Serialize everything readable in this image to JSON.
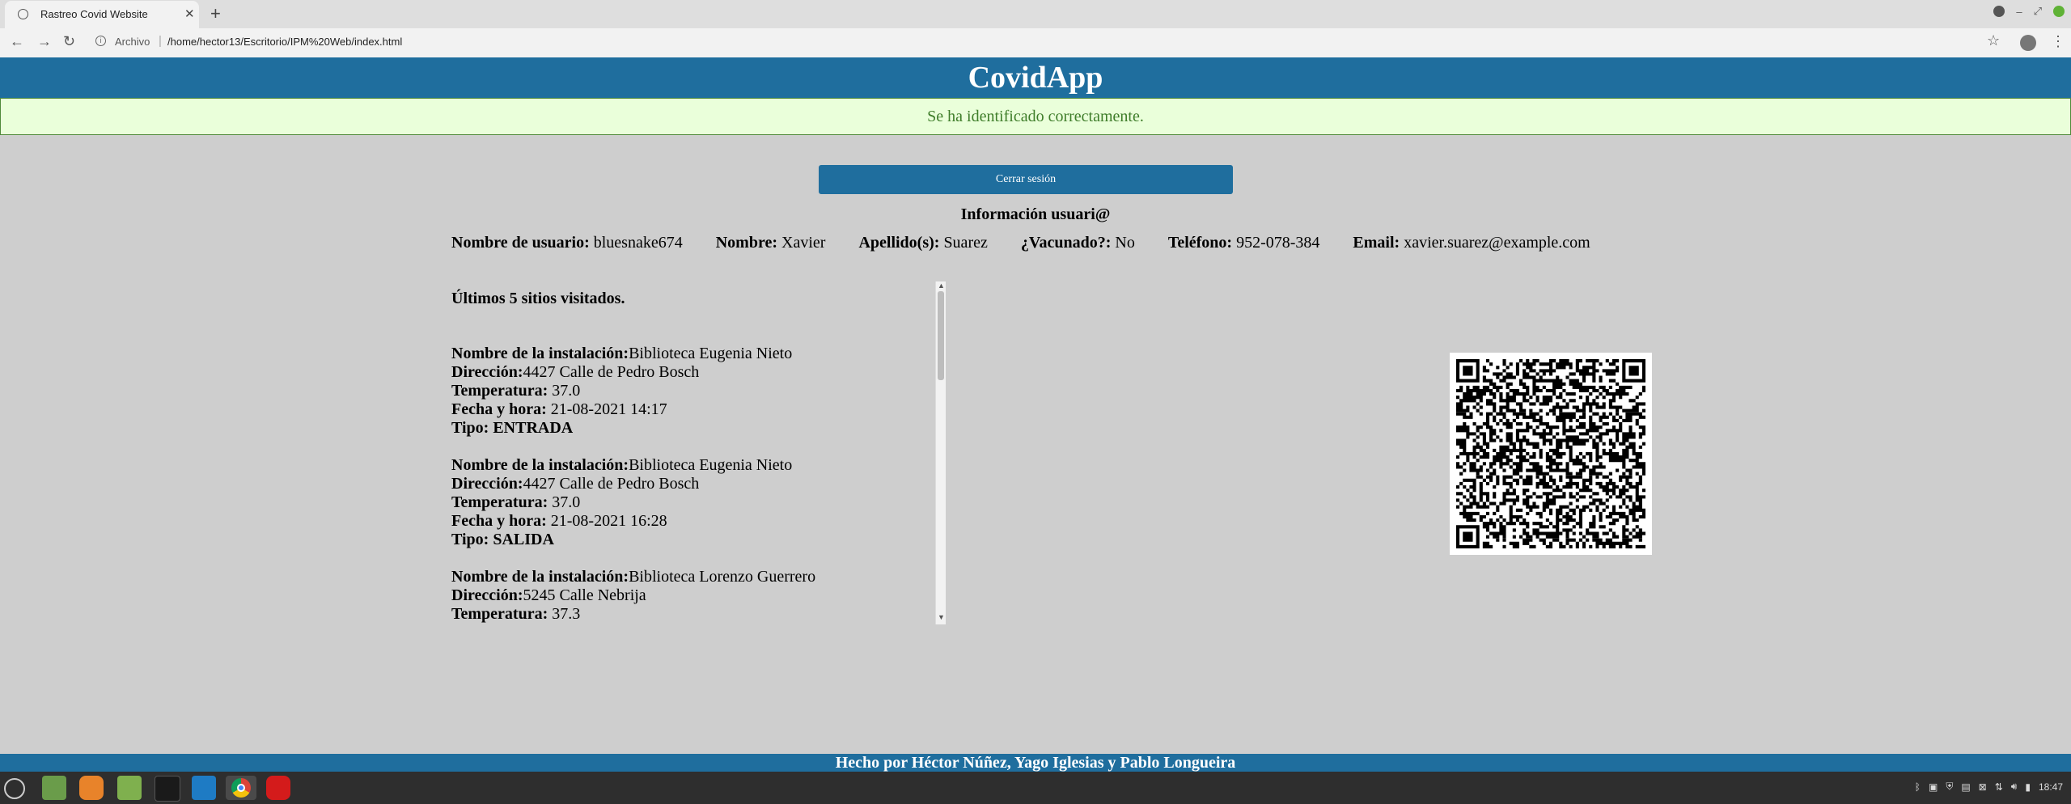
{
  "browser": {
    "tab_title": "Rastreo Covid Website",
    "url_label": "Archivo",
    "url": "/home/hector13/Escritorio/IPM%20Web/index.html"
  },
  "page": {
    "app_title": "CovidApp",
    "alert": "Se ha identificado correctamente.",
    "logout_label": "Cerrar sesión",
    "info_title": "Información usuari@",
    "user_fields": [
      {
        "label": "Nombre de usuario:",
        "value": " bluesnake674"
      },
      {
        "label": "Nombre:",
        "value": " Xavier"
      },
      {
        "label": "Apellido(s):",
        "value": " Suarez"
      },
      {
        "label": "¿Vacunado?:",
        "value": " No"
      },
      {
        "label": "Teléfono:",
        "value": " 952-078-384"
      },
      {
        "label": "Email:",
        "value": " xavier.suarez@example.com"
      }
    ],
    "visits_title": "Últimos 5 sitios visitados.",
    "visits": [
      {
        "lbl_inst": "Nombre de la instalación:",
        "inst": "Biblioteca Eugenia Nieto",
        "lbl_dir": "Dirección:",
        "dir": "4427 Calle de Pedro Bosch",
        "lbl_temp": "Temperatura:",
        "temp": " 37.0",
        "lbl_date": "Fecha y hora:",
        "date": " 21-08-2021 14:17",
        "type": "Tipo: ENTRADA"
      },
      {
        "lbl_inst": "Nombre de la instalación:",
        "inst": "Biblioteca Eugenia Nieto",
        "lbl_dir": "Dirección:",
        "dir": "4427 Calle de Pedro Bosch",
        "lbl_temp": "Temperatura:",
        "temp": " 37.0",
        "lbl_date": "Fecha y hora:",
        "date": " 21-08-2021 16:28",
        "type": "Tipo: SALIDA"
      },
      {
        "lbl_inst": "Nombre de la instalación:",
        "inst": "Biblioteca Lorenzo Guerrero",
        "lbl_dir": "Dirección:",
        "dir": "5245 Calle Nebrija",
        "lbl_temp": "Temperatura:",
        "temp": " 37.3",
        "lbl_date": "",
        "date": "",
        "type": ""
      }
    ],
    "footer": "Hecho por Héctor Núñez, Yago Iglesias y Pablo Longueira"
  },
  "taskbar": {
    "clock": "18:47",
    "apps": [
      "mint-menu-icon",
      "show-desktop-icon",
      "firefox-icon",
      "files-icon",
      "terminal-icon",
      "vscode-icon",
      "chrome-icon",
      "opera-icon"
    ]
  },
  "colors": {
    "primary": "#1f6e9e",
    "alert_bg": "#eaffda",
    "alert_text": "#3f7d2a",
    "page_bg": "#cecece"
  }
}
